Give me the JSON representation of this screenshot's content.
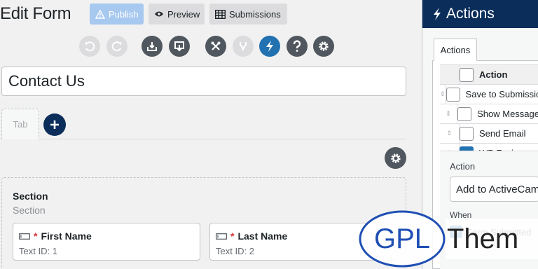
{
  "header": {
    "title": "Edit Form",
    "publish_label": "Publish",
    "preview_label": "Preview",
    "submissions_label": "Submissions"
  },
  "toolbar": {
    "icons": [
      "undo-icon",
      "redo-icon",
      "import-icon",
      "export-icon",
      "tools-icon",
      "merge-tags-icon",
      "actions-icon",
      "help-icon",
      "settings-icon"
    ]
  },
  "form": {
    "title_value": "Contact Us",
    "tab_label": "Tab"
  },
  "section": {
    "title": "Section",
    "subtitle": "Section",
    "fields": [
      {
        "label": "First Name",
        "required_mark": "*",
        "type": "Text",
        "id": "ID: 1"
      },
      {
        "label": "Last Name",
        "required_mark": "*",
        "type": "Text",
        "id": "ID: 2"
      }
    ]
  },
  "panel": {
    "title": "Actions",
    "tab_label": "Actions",
    "table_header": "Action",
    "actions": [
      {
        "name": "Save to Submissions",
        "checked": false
      },
      {
        "name": "Show Message",
        "checked": false
      },
      {
        "name": "Send Email",
        "checked": false
      },
      {
        "name": "WP Fusion",
        "checked": true
      }
    ],
    "detail_label": "Action",
    "detail_value": "Add to ActiveCampaign",
    "when_label": "When",
    "trigger_label": "Form Submitted"
  },
  "watermark": {
    "logo_text": "GPL",
    "text": "Them"
  },
  "colors": {
    "navy": "#0a2d5a",
    "accent_blue": "#2271b1",
    "publish_bg": "#a7c8ef",
    "required_red": "#d63638"
  }
}
